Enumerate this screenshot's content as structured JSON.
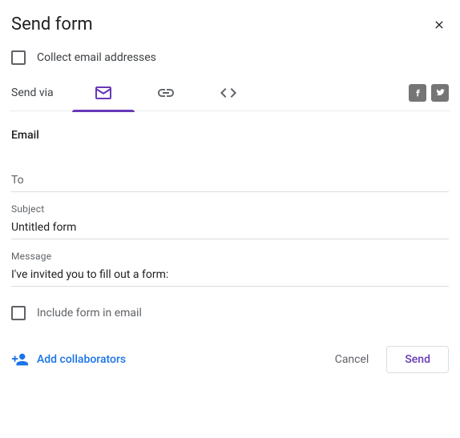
{
  "dialog": {
    "title": "Send form",
    "collect_label": "Collect email addresses",
    "send_via_label": "Send via"
  },
  "tabs": {
    "email": "Email",
    "link": "Link",
    "embed": "Embed HTML"
  },
  "social": {
    "facebook": "Share on Facebook",
    "twitter": "Share on Twitter"
  },
  "email_section": {
    "title": "Email",
    "to_label": "To",
    "to_value": "",
    "subject_label": "Subject",
    "subject_value": "Untitled form",
    "message_label": "Message",
    "message_value": "I've invited you to fill out a form:",
    "include_label": "Include form in email"
  },
  "footer": {
    "collaborators": "Add collaborators",
    "cancel": "Cancel",
    "send": "Send"
  }
}
